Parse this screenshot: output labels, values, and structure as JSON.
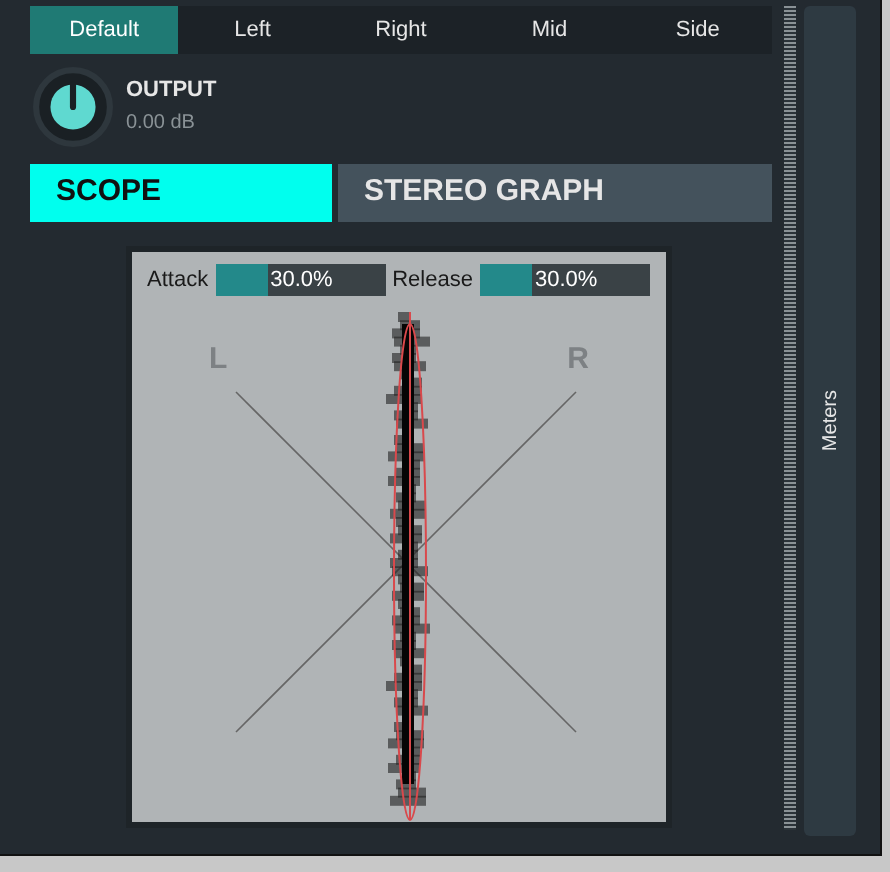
{
  "channel_tabs": [
    {
      "label": "Default",
      "selected": true
    },
    {
      "label": "Left",
      "selected": false
    },
    {
      "label": "Right",
      "selected": false
    },
    {
      "label": "Mid",
      "selected": false
    },
    {
      "label": "Side",
      "selected": false
    }
  ],
  "output": {
    "label": "OUTPUT",
    "reading": "0.00 dB"
  },
  "view_tabs": [
    {
      "label": "SCOPE",
      "selected": true
    },
    {
      "label": "STEREO GRAPH",
      "selected": false
    }
  ],
  "scope": {
    "attack": {
      "label": "Attack",
      "level": 0.3,
      "reading": "30.0%"
    },
    "release": {
      "label": "Release",
      "level": 0.3,
      "reading": "30.0%"
    },
    "left_label": "L",
    "right_label": "R"
  },
  "side_panel": {
    "label": "Meters"
  }
}
